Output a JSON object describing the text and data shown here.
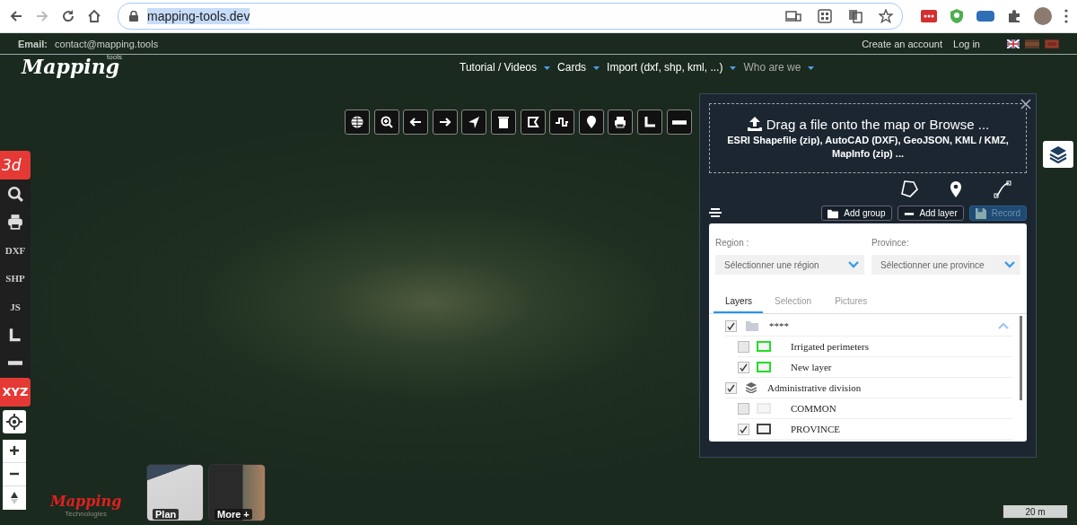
{
  "browser": {
    "url": "mapping-tools.dev",
    "forward_disabled": true
  },
  "top_bar": {
    "email_label": "Email:",
    "email": "contact@mapping.tools",
    "links": [
      "Create an account",
      "Log in"
    ]
  },
  "logo": {
    "text": "Mapping",
    "superscript": "tools"
  },
  "nav": [
    {
      "label": "Tutorial / Videos"
    },
    {
      "label": "Cards"
    },
    {
      "label": "Import (dxf, shp, kml, ...)"
    },
    {
      "label": "Who are we"
    }
  ],
  "sidebar": [
    {
      "kind": "text",
      "label": "3d",
      "accent": true
    },
    {
      "kind": "search"
    },
    {
      "kind": "print"
    },
    {
      "kind": "text",
      "label": "DXF",
      "accent": false
    },
    {
      "kind": "text",
      "label": "SHP",
      "accent": false
    },
    {
      "kind": "text",
      "label": "JS",
      "accent": false
    },
    {
      "kind": "angle"
    },
    {
      "kind": "ruler"
    },
    {
      "kind": "text",
      "label": "XYZ",
      "accent": true
    }
  ],
  "basemaps": [
    {
      "label": "Plan"
    },
    {
      "label": "More +"
    }
  ],
  "bottom_logo": {
    "text": "Mapping",
    "subtitle": "Technologies"
  },
  "scale": "20 m",
  "panel": {
    "upload": {
      "title": "Drag a file onto the map or Browse ...",
      "formats": "ESRI Shapefile (zip), AutoCAD (DXF), GeoJSON, KML / KMZ, MapInfo (zip) ..."
    },
    "actions": [
      {
        "label": "Add group",
        "kind": "folder",
        "disabled": false
      },
      {
        "label": "Add layer",
        "kind": "minus",
        "disabled": false
      },
      {
        "label": "Record",
        "kind": "save",
        "disabled": true
      }
    ],
    "filters": [
      {
        "label": "Region :",
        "placeholder": "Sélectionner une région"
      },
      {
        "label": "Province:",
        "placeholder": "Sélectionner une province"
      }
    ],
    "tabs": [
      {
        "label": "Layers",
        "selected": true
      },
      {
        "label": "Selection",
        "selected": false
      },
      {
        "label": "Pictures",
        "selected": false
      }
    ],
    "layers": [
      {
        "kind": "folder",
        "label": "****",
        "checked": true,
        "expanded": true,
        "children": [
          {
            "kind": "layer",
            "label": "Irrigated perimeters",
            "checked": false,
            "color": "#22dd22"
          },
          {
            "kind": "layer",
            "label": "New layer",
            "checked": true,
            "color": "#22dd22"
          }
        ]
      },
      {
        "kind": "stack",
        "label": "Administrative division",
        "checked": true,
        "children": [
          {
            "kind": "layer",
            "label": "COMMON",
            "checked": false,
            "color": "#e8e8e8"
          },
          {
            "kind": "layer",
            "label": "PROVINCE",
            "checked": true,
            "color": "#444444"
          }
        ]
      }
    ]
  }
}
